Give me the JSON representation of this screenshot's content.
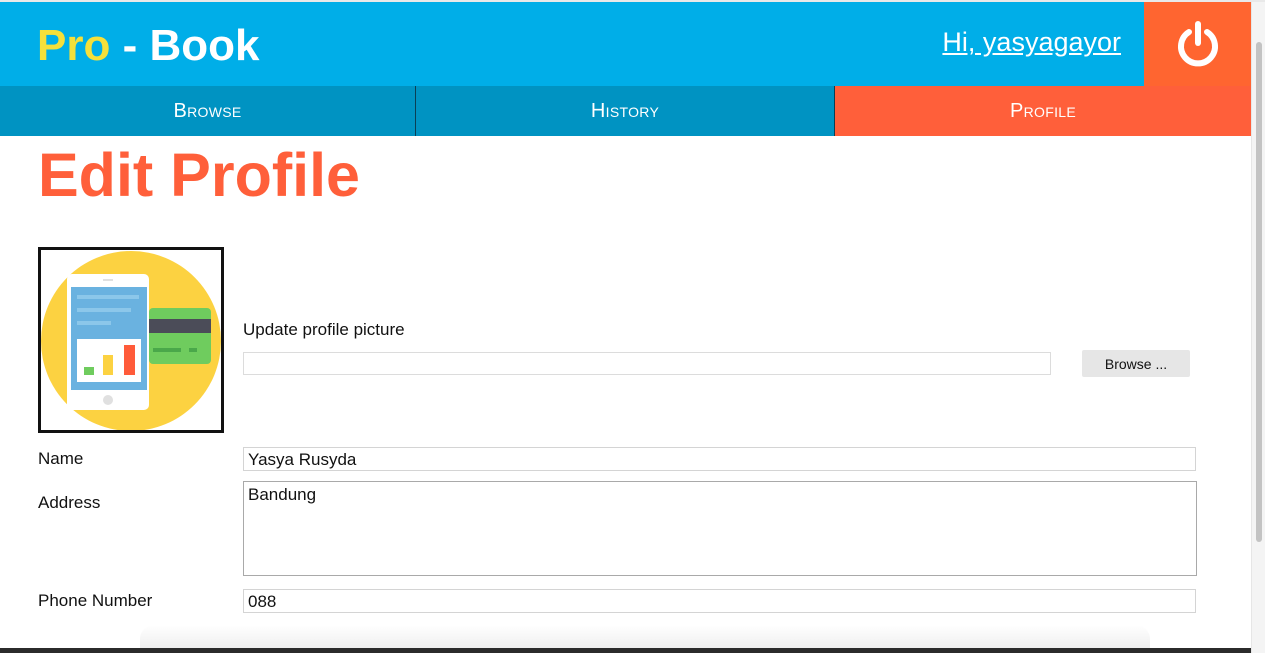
{
  "header": {
    "logo_pro": "Pro",
    "logo_rest": " - Book",
    "greeting": "Hi, yasyagayor",
    "logout_icon": "power-icon"
  },
  "nav": {
    "tabs": [
      {
        "label": "Browse",
        "active": false
      },
      {
        "label": "History",
        "active": false
      },
      {
        "label": "Profile",
        "active": true
      }
    ]
  },
  "main": {
    "title": "Edit Profile",
    "avatar_icon": "tablet-chart-card-illustration",
    "update_picture_label": "Update profile picture",
    "file_value": "",
    "browse_button": "Browse ...",
    "fields": {
      "name": {
        "label": "Name",
        "value": "Yasya Rusyda"
      },
      "address": {
        "label": "Address",
        "value": "Bandung"
      },
      "phone": {
        "label": "Phone Number",
        "value": "088"
      }
    }
  },
  "colors": {
    "header_bg": "#00aee8",
    "nav_bg": "#0093c2",
    "accent": "#ff5f3a",
    "logout_bg": "#ff6530",
    "logo_yellow": "#f5e03a"
  }
}
